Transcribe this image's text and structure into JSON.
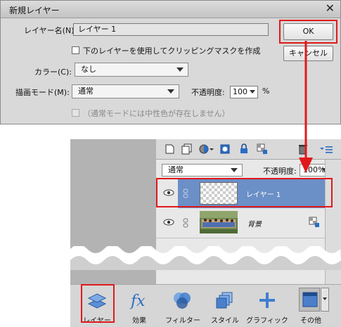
{
  "dialog": {
    "title": "新規レイヤー",
    "name_label": "レイヤー名(N):",
    "name_value": "レイヤー 1",
    "clip_checkbox_label": "下のレイヤーを使用してクリッピングマスクを作成",
    "color_label": "カラー(C):",
    "color_value": "なし",
    "mode_label": "描画モード(M):",
    "mode_value": "通常",
    "opacity_label": "不透明度:",
    "opacity_value": "100",
    "opacity_unit": "%",
    "neutral_label": "（通常モードには中性色が存在しません）",
    "ok_label": "OK",
    "cancel_label": "キャンセル"
  },
  "panel": {
    "blend_mode": "通常",
    "opacity_label": "不透明度:",
    "opacity_value": "100%",
    "layers": [
      {
        "name": "レイヤー 1",
        "selected": true
      },
      {
        "name": "背景",
        "selected": false
      }
    ]
  },
  "bottom_tools": [
    {
      "label": "レイヤー",
      "icon": "layers-icon"
    },
    {
      "label": "効果",
      "icon": "fx-icon"
    },
    {
      "label": "フィルター",
      "icon": "filter-circles-icon"
    },
    {
      "label": "スタイル",
      "icon": "styles-icon"
    },
    {
      "label": "グラフィック",
      "icon": "plus-icon"
    },
    {
      "label": "その他",
      "icon": "window-icon"
    }
  ],
  "colors": {
    "highlight_red": "#e0191b",
    "selected_layer": "#6b8fc7",
    "accent_blue": "#2b6cc4"
  }
}
